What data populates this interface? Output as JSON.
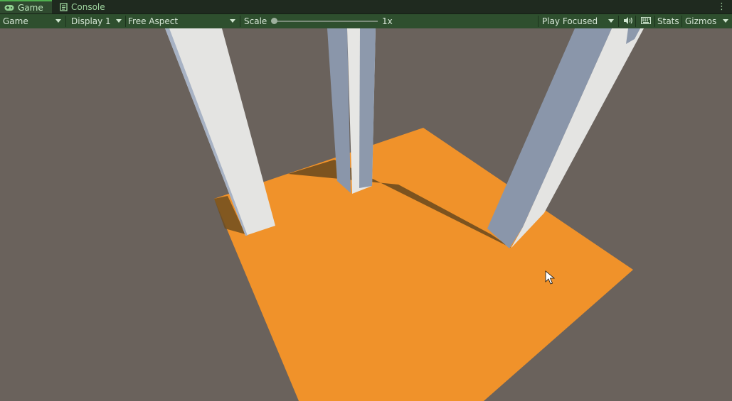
{
  "tabs": [
    {
      "label": "Game",
      "icon": "gamepad-icon",
      "active": true
    },
    {
      "label": "Console",
      "icon": "console-icon",
      "active": false
    }
  ],
  "toolbar": {
    "view_select": "Game",
    "display": "Display 1",
    "aspect": "Free Aspect",
    "scale_label": "Scale",
    "scale_value": "1x",
    "play_mode": "Play Focused",
    "stats_label": "Stats",
    "gizmos_label": "Gizmos"
  },
  "colors": {
    "background": "#6a625c",
    "floor": "#f0922a",
    "pillar_light": "#e4e4e2",
    "pillar_dark": "#8a96aa",
    "accent": "#4fb04f"
  }
}
